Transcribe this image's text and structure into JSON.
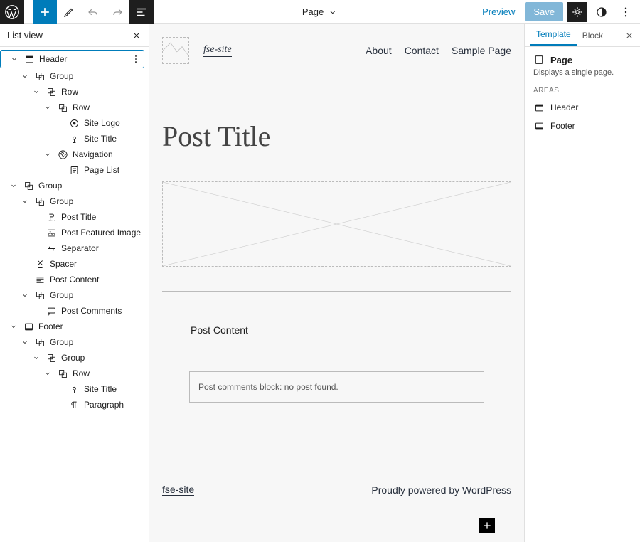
{
  "topbar": {
    "center_label": "Page",
    "preview": "Preview",
    "save": "Save"
  },
  "listview": {
    "title": "List view",
    "items": [
      {
        "indent": 0,
        "caret": "down",
        "icon": "header",
        "label": "Header",
        "selected": true,
        "more": true
      },
      {
        "indent": 1,
        "caret": "down",
        "icon": "group",
        "label": "Group"
      },
      {
        "indent": 2,
        "caret": "down",
        "icon": "group",
        "label": "Row"
      },
      {
        "indent": 3,
        "caret": "down",
        "icon": "group",
        "label": "Row"
      },
      {
        "indent": 4,
        "caret": "none",
        "icon": "site-logo",
        "label": "Site Logo"
      },
      {
        "indent": 4,
        "caret": "none",
        "icon": "site-title",
        "label": "Site Title"
      },
      {
        "indent": 3,
        "caret": "down",
        "icon": "navigation",
        "label": "Navigation"
      },
      {
        "indent": 4,
        "caret": "none",
        "icon": "page-list",
        "label": "Page List"
      },
      {
        "indent": 0,
        "caret": "down",
        "icon": "group",
        "label": "Group"
      },
      {
        "indent": 1,
        "caret": "down",
        "icon": "group",
        "label": "Group"
      },
      {
        "indent": 2,
        "caret": "none",
        "icon": "post-title",
        "label": "Post Title"
      },
      {
        "indent": 2,
        "caret": "none",
        "icon": "featured-image",
        "label": "Post Featured Image"
      },
      {
        "indent": 2,
        "caret": "none",
        "icon": "separator",
        "label": "Separator"
      },
      {
        "indent": 1,
        "caret": "none",
        "icon": "spacer",
        "label": "Spacer"
      },
      {
        "indent": 1,
        "caret": "none",
        "icon": "post-content",
        "label": "Post Content"
      },
      {
        "indent": 1,
        "caret": "down",
        "icon": "group",
        "label": "Group"
      },
      {
        "indent": 2,
        "caret": "none",
        "icon": "post-comments",
        "label": "Post Comments"
      },
      {
        "indent": 0,
        "caret": "down",
        "icon": "footer",
        "label": "Footer"
      },
      {
        "indent": 1,
        "caret": "down",
        "icon": "group",
        "label": "Group"
      },
      {
        "indent": 2,
        "caret": "down",
        "icon": "group",
        "label": "Group"
      },
      {
        "indent": 3,
        "caret": "down",
        "icon": "group",
        "label": "Row"
      },
      {
        "indent": 4,
        "caret": "none",
        "icon": "site-title",
        "label": "Site Title"
      },
      {
        "indent": 4,
        "caret": "none",
        "icon": "paragraph",
        "label": "Paragraph"
      }
    ]
  },
  "canvas": {
    "site_title": "fse-site",
    "nav": [
      "About",
      "Contact",
      "Sample Page"
    ],
    "post_title": "Post Title",
    "post_content_label": "Post Content",
    "comments_msg": "Post comments block: no post found.",
    "footer_site": "fse-site",
    "footer_text": "Proudly powered by ",
    "footer_link": "WordPress"
  },
  "right": {
    "tabs": [
      "Template",
      "Block"
    ],
    "page_label": "Page",
    "page_desc": "Displays a single page.",
    "areas_heading": "AREAS",
    "areas": [
      {
        "icon": "header",
        "label": "Header"
      },
      {
        "icon": "footer",
        "label": "Footer"
      }
    ]
  }
}
